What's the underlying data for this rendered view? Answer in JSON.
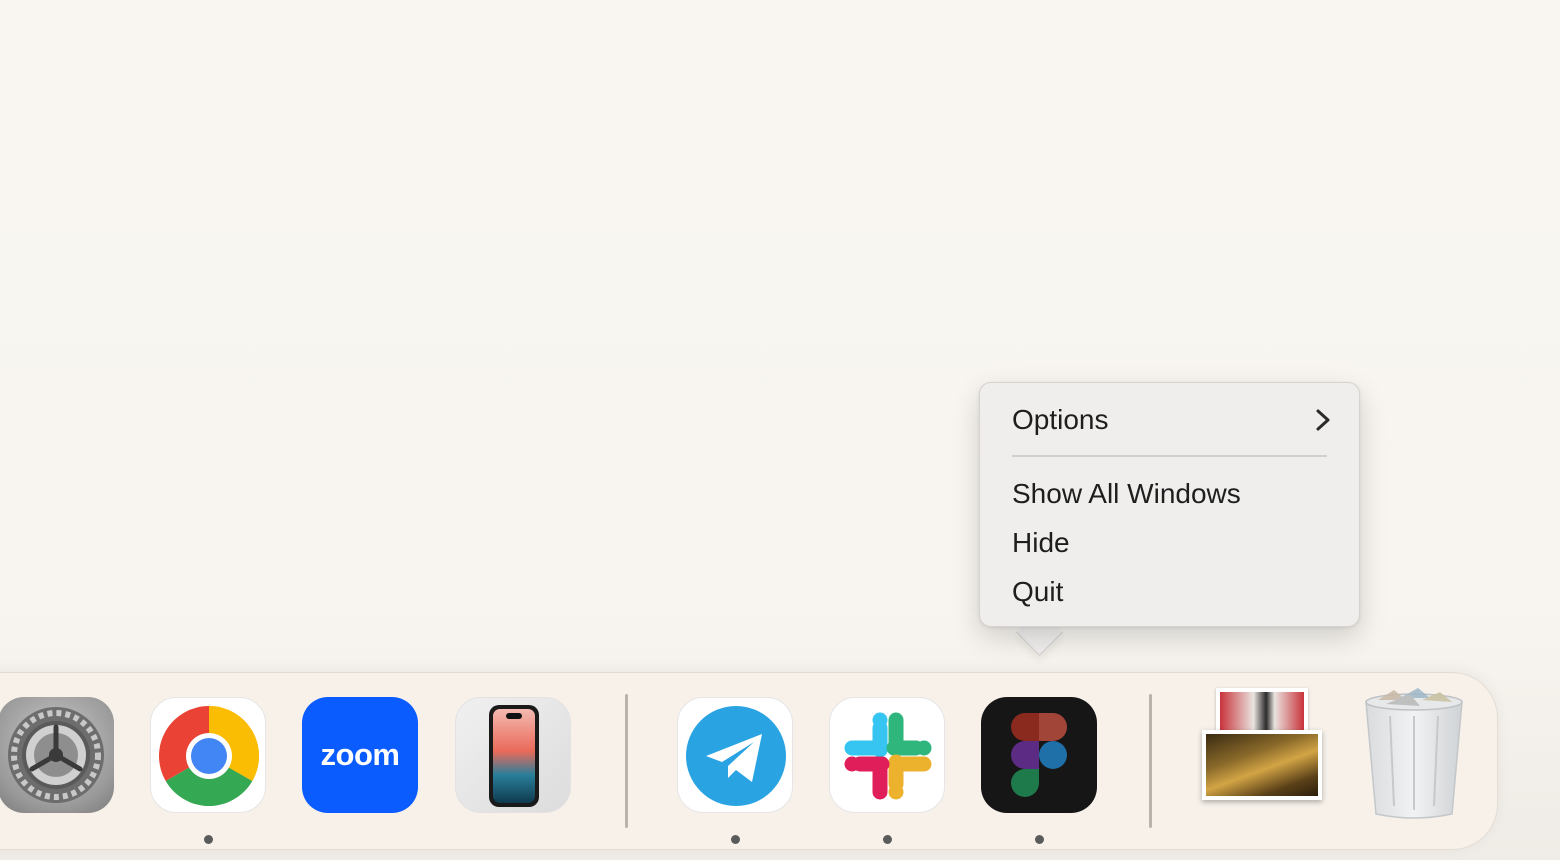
{
  "context_menu": {
    "items": [
      {
        "label": "Options",
        "has_submenu": true,
        "submenu_icon": "chevron-right-icon"
      },
      {
        "label": "Show All Windows"
      },
      {
        "label": "Hide"
      },
      {
        "label": "Quit"
      }
    ]
  },
  "dock": {
    "apps": [
      {
        "name": "System Settings",
        "icon": "gear-icon",
        "running": false
      },
      {
        "name": "Google Chrome",
        "icon": "chrome-icon",
        "running": true
      },
      {
        "name": "Zoom",
        "icon": "zoom-icon",
        "label": "zoom",
        "running": false
      },
      {
        "name": "iPhone Mirroring",
        "icon": "iphone-icon",
        "running": false
      },
      {
        "name": "Telegram",
        "icon": "telegram-icon",
        "running": true
      },
      {
        "name": "Slack",
        "icon": "slack-icon",
        "running": true
      },
      {
        "name": "Figma",
        "icon": "figma-icon",
        "running": true
      }
    ],
    "stack": {
      "icon": "photos-stack-icon"
    },
    "trash": {
      "icon": "trash-icon",
      "state": "full"
    }
  },
  "colors": {
    "zoom_blue": "#0b5cff",
    "telegram_blue": "#2aa3e3",
    "figma_bg": "#161616",
    "chrome_red": "#ea4335",
    "chrome_yellow": "#fbbc04",
    "chrome_green": "#34a853",
    "chrome_blue": "#4285f4"
  }
}
